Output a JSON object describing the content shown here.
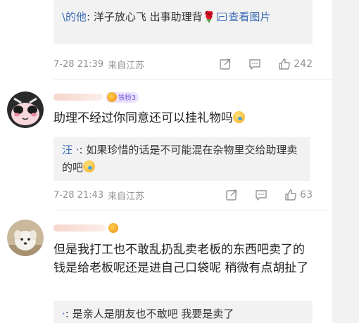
{
  "comments": [
    {
      "reply": {
        "user": "\\的他",
        "text": ": 洋子放心飞 出事助理背",
        "link_label": "查看图片"
      },
      "time": "7-28 21:39",
      "location": "来自江苏",
      "likes": "242"
    },
    {
      "badge": "铁粉3",
      "text": "助理不经过你同意还可以挂礼物吗",
      "reply": {
        "user": "汪 ·",
        "text": ": 如果珍惜的话是不可能混在杂物里交给助理卖的吧"
      },
      "time": "7-28 21:43",
      "location": "来自江苏",
      "likes": "63"
    },
    {
      "text": "但是我打工也不敢乱扔乱卖老板的东西吧卖了的钱是给老板呢还是进自己口袋呢 稍微有点胡扯了",
      "reply": {
        "user": "·",
        "text": ": 是亲人是朋友也不敢吧 我要是卖了"
      }
    }
  ]
}
